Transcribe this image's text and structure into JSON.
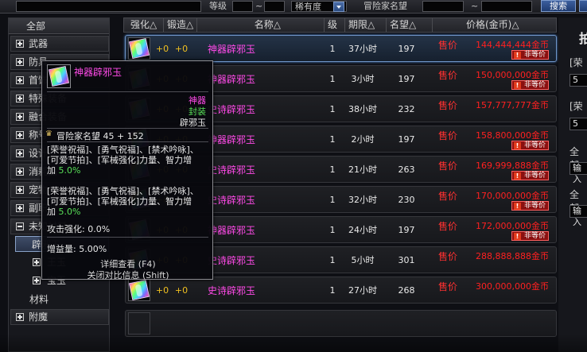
{
  "search": {
    "level_label": "等级",
    "rarity_label": "稀有度",
    "reputation_label": "冒险家名望",
    "search_button": "搜索",
    "level_from": "",
    "level_to": "",
    "reputation_from": "",
    "reputation_to": ""
  },
  "categories": {
    "all": "全部",
    "items": [
      {
        "label": "武器"
      },
      {
        "label": "防具"
      },
      {
        "label": "首饰"
      },
      {
        "label": "特殊装备"
      },
      {
        "label": "融合装备"
      },
      {
        "label": "称号"
      },
      {
        "label": "设计图"
      },
      {
        "label": "消耗品"
      },
      {
        "label": "宠物"
      },
      {
        "label": "副职业"
      }
    ],
    "expanded": {
      "label": "未知材料",
      "selected_sub": "辟邪玉",
      "subsubs": [
        "王玉",
        "宝玉"
      ]
    },
    "material": "材料",
    "enchant": "附魔"
  },
  "list": {
    "headers": {
      "strengthen": "强化△",
      "forge": "锻造△",
      "name": "名称△",
      "level": "级△",
      "duration": "期限△",
      "reputation": "名望△",
      "price": "价格(金币)△"
    },
    "sale_label": "售价",
    "badge_label": "非等价",
    "rows": [
      {
        "strengthen": "+0",
        "forge": "+0",
        "name": "神器辟邪玉",
        "level": "1",
        "duration": "37小时",
        "reputation": "197",
        "price": "144,444,444金币",
        "badge": true
      },
      {
        "strengthen": "+0",
        "forge": "+0",
        "name": "神器辟邪玉",
        "level": "1",
        "duration": "3小时",
        "reputation": "197",
        "price": "150,000,000金币",
        "badge": true
      },
      {
        "strengthen": "+0",
        "forge": "+0",
        "name": "史诗辟邪玉",
        "level": "1",
        "duration": "38小时",
        "reputation": "232",
        "price": "157,777,777金币",
        "badge": false
      },
      {
        "strengthen": "+0",
        "forge": "+0",
        "name": "神器辟邪玉",
        "level": "1",
        "duration": "2小时",
        "reputation": "197",
        "price": "158,800,000金币",
        "badge": true
      },
      {
        "strengthen": "+0",
        "forge": "+0",
        "name": "史诗辟邪玉",
        "level": "1",
        "duration": "21小时",
        "reputation": "263",
        "price": "169,999,888金币",
        "badge": true
      },
      {
        "strengthen": "+0",
        "forge": "+0",
        "name": "史诗辟邪玉",
        "level": "1",
        "duration": "32小时",
        "reputation": "230",
        "price": "170,000,000金币",
        "badge": true
      },
      {
        "strengthen": "+0",
        "forge": "+0",
        "name": "神器辟邪玉",
        "level": "1",
        "duration": "24小时",
        "reputation": "197",
        "price": "172,000,000金币",
        "badge": true
      },
      {
        "strengthen": "+0",
        "forge": "+0",
        "name": "史诗辟邪玉",
        "level": "1",
        "duration": "5小时",
        "reputation": "301",
        "price": "288,888,888金币",
        "badge": false
      },
      {
        "strengthen": "+0",
        "forge": "+0",
        "name": "史诗辟邪玉",
        "level": "1",
        "duration": "27小时",
        "reputation": "268",
        "price": "300,000,000金币",
        "badge": false
      }
    ]
  },
  "tooltip": {
    "title": "神器辟邪玉",
    "rarity": "神器",
    "sealed": "封装",
    "type": "辟邪玉",
    "reputation": "冒险家名望 45 + 152",
    "effect1_line1": "[荣誉祝福]、[勇气祝福]、[禁术吟咏]、",
    "effect1_line2": "[可爱节拍]、[军械强化]力量、智力增",
    "effect1_line3": "加",
    "effect1_value": "5.0%",
    "effect2_line1": "[荣誉祝福]、[勇气祝福]、[禁术吟咏]、",
    "effect2_line2": "[可爱节拍]、[军械强化]力量、智力增",
    "effect2_line3": "加",
    "effect2_value": "5.0%",
    "attack_label": "攻击强化:",
    "attack_value": "0.0%",
    "gain_label": "增益量:",
    "gain_value": "5.00%",
    "detail": "详细查看 (F4)",
    "close": "关闭对比信息 (Shift)"
  },
  "rightpanel": {
    "big": "拍",
    "label1": "[荣",
    "input1": "5",
    "label2": "[荣",
    "input2": "5",
    "label3": "全部",
    "input3": "输入",
    "label4": "全部",
    "input4": "输入"
  }
}
